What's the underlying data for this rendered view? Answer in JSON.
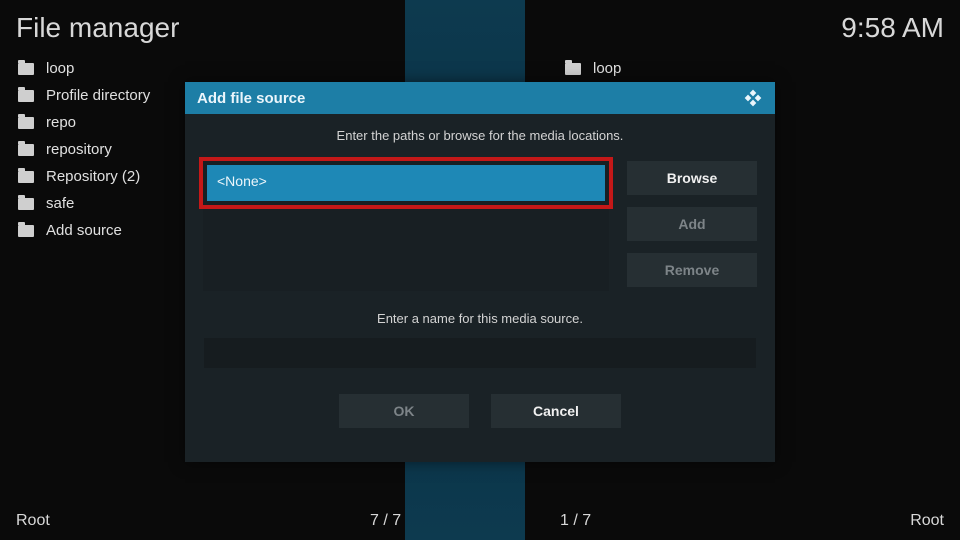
{
  "header": {
    "title": "File manager",
    "clock": "9:58 AM"
  },
  "left_pane": {
    "items": [
      {
        "label": "loop"
      },
      {
        "label": "Profile directory"
      },
      {
        "label": "repo"
      },
      {
        "label": "repository"
      },
      {
        "label": "Repository (2)"
      },
      {
        "label": "safe"
      },
      {
        "label": "Add source"
      }
    ]
  },
  "right_pane": {
    "items": [
      {
        "label": "loop"
      }
    ]
  },
  "footer": {
    "left_label": "Root",
    "left_count": "7 / 7",
    "right_count": "1 / 7",
    "right_label": "Root"
  },
  "dialog": {
    "title": "Add file source",
    "instruction": "Enter the paths or browse for the media locations.",
    "path_value": "<None>",
    "browse": "Browse",
    "add": "Add",
    "remove": "Remove",
    "name_label": "Enter a name for this media source.",
    "name_value": "",
    "ok": "OK",
    "cancel": "Cancel"
  }
}
